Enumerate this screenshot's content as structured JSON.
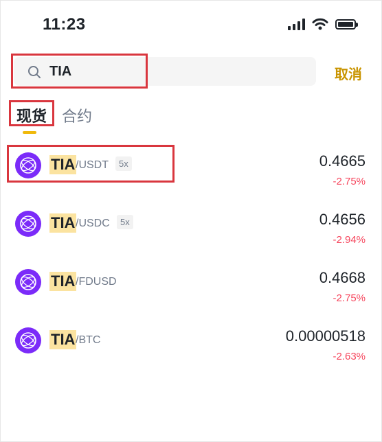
{
  "status_bar": {
    "time": "11:23",
    "icons": [
      "signal-icon",
      "wifi-icon",
      "battery-icon"
    ]
  },
  "search": {
    "query": "TIA",
    "cancel_label": "取消"
  },
  "tabs": [
    {
      "label": "现货",
      "active": true
    },
    {
      "label": "合约",
      "active": false
    }
  ],
  "pairs": [
    {
      "base": "TIA",
      "quote": "/USDT",
      "leverage": "5x",
      "price": "0.4665",
      "change": "-2.75%"
    },
    {
      "base": "TIA",
      "quote": "/USDC",
      "leverage": "5x",
      "price": "0.4656",
      "change": "-2.94%"
    },
    {
      "base": "TIA",
      "quote": "/FDUSD",
      "leverage": "",
      "price": "0.4668",
      "change": "-2.75%"
    },
    {
      "base": "TIA",
      "quote": "/BTC",
      "leverage": "",
      "price": "0.00000518",
      "change": "-2.63%"
    }
  ],
  "colors": {
    "accent": "#f0b90b",
    "accent_text": "#c99400",
    "negative": "#f6465d",
    "highlight": "#fbe3a0",
    "annotation_box": "#d9363e",
    "coin": "#7b2bf9"
  }
}
